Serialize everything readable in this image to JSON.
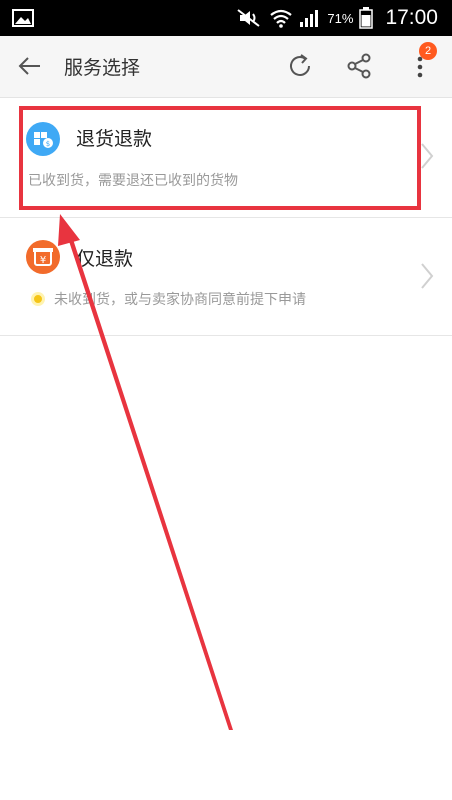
{
  "status_bar": {
    "battery_percent": "71%",
    "time": "17:00",
    "icons": [
      "gallery-icon",
      "mute-icon",
      "wifi-icon",
      "signal-icon",
      "battery-icon"
    ]
  },
  "header": {
    "title": "服务选择",
    "badge_count": "2",
    "icons": [
      "back-arrow-icon",
      "refresh-icon",
      "share-icon",
      "more-vertical-icon"
    ]
  },
  "options": [
    {
      "label": "退货退款",
      "description": "已收到货，需要退还已收到的货物",
      "icon": "return-goods-icon",
      "icon_color": "#3fa9f5"
    },
    {
      "label": "仅退款",
      "description": "未收到货，或与卖家协商同意前提下申请",
      "icon": "refund-yen-icon",
      "icon_color": "#f26b2b"
    }
  ],
  "colors": {
    "annotation": "#e8343f",
    "badge": "#ff5a1f",
    "header_bg": "#f6f6f6"
  }
}
